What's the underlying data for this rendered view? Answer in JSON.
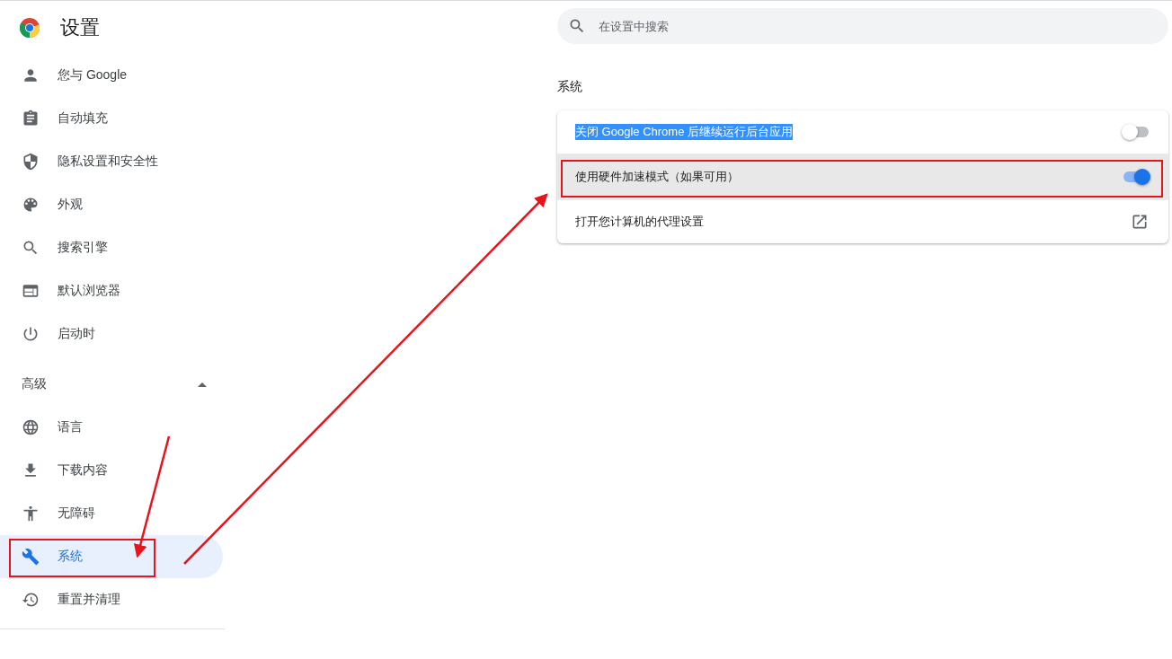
{
  "header": {
    "title": "设置"
  },
  "search": {
    "placeholder": "在设置中搜索"
  },
  "sidebar": {
    "items": [
      {
        "label": "您与 Google",
        "selected": false,
        "annotated": false
      },
      {
        "label": "自动填充",
        "selected": false,
        "annotated": false
      },
      {
        "label": "隐私设置和安全性",
        "selected": false,
        "annotated": false
      },
      {
        "label": "外观",
        "selected": false,
        "annotated": false
      },
      {
        "label": "搜索引擎",
        "selected": false,
        "annotated": false
      },
      {
        "label": "默认浏览器",
        "selected": false,
        "annotated": false
      },
      {
        "label": "启动时",
        "selected": false,
        "annotated": false
      }
    ],
    "advanced": {
      "label": "高级",
      "expanded": true,
      "items": [
        {
          "label": "语言",
          "selected": false,
          "annotated": false
        },
        {
          "label": "下载内容",
          "selected": false,
          "annotated": false
        },
        {
          "label": "无障碍",
          "selected": false,
          "annotated": false
        },
        {
          "label": "系统",
          "selected": true,
          "annotated": true
        },
        {
          "label": "重置并清理",
          "selected": false,
          "annotated": false
        }
      ]
    }
  },
  "section": {
    "title": "系统",
    "rows": [
      {
        "kind": "toggle",
        "label": "关闭 Google Chrome 后继续运行后台应用",
        "text_selected": true,
        "hovered": false,
        "annotated": false,
        "on": false
      },
      {
        "kind": "toggle",
        "label": "使用硬件加速模式（如果可用）",
        "text_selected": false,
        "hovered": true,
        "annotated": true,
        "on": true
      },
      {
        "kind": "link",
        "label": "打开您计算机的代理设置",
        "text_selected": false,
        "hovered": false,
        "annotated": false
      }
    ]
  }
}
